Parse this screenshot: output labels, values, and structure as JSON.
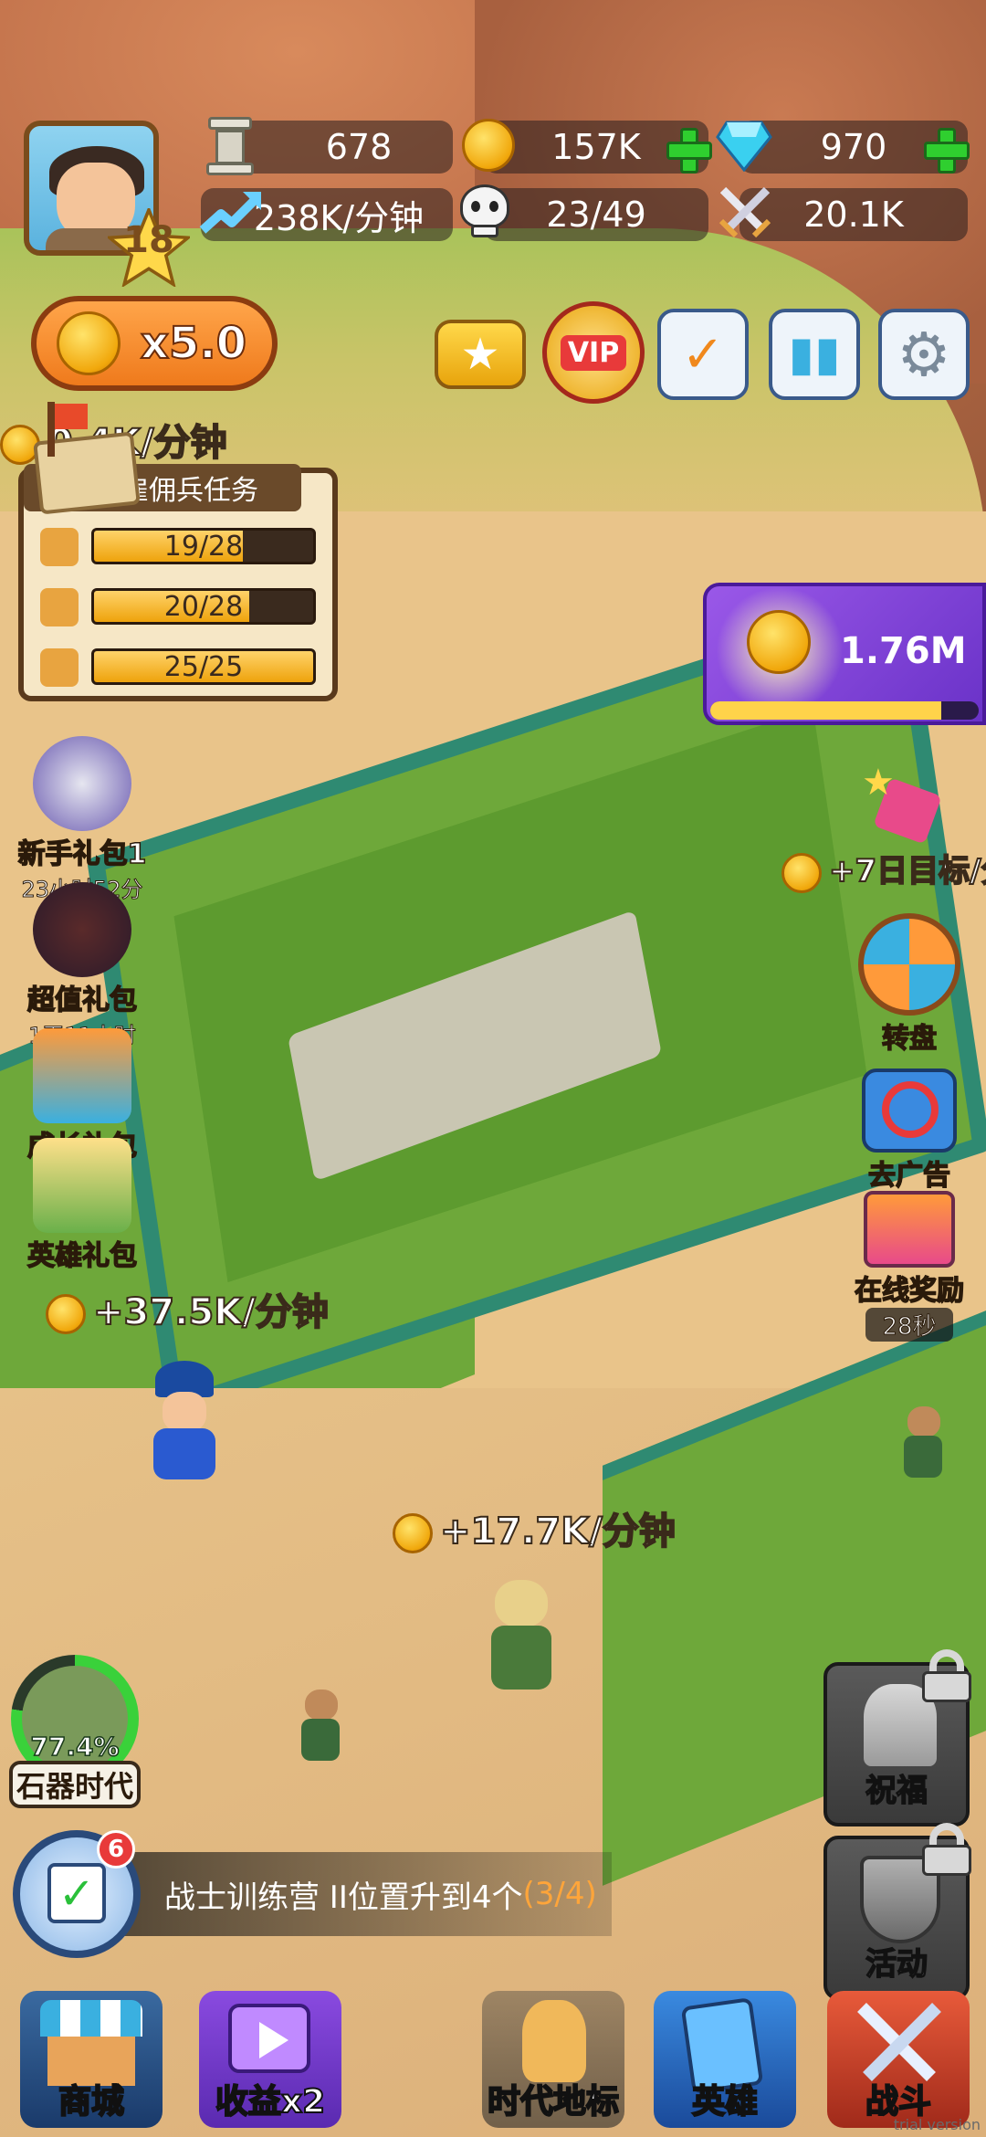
{
  "player": {
    "level": "18"
  },
  "resources": {
    "stone": "678",
    "gold": "157K",
    "gems": "970",
    "income_rate": "238K/分钟",
    "population": "23/49",
    "power": "20.1K"
  },
  "multiplier_button": {
    "label": "x5.0"
  },
  "income_labels": {
    "top": "0.4K/分钟",
    "field": "+37.5K/分钟",
    "camp": "+17.7K/分钟",
    "right": "+7日目标/分"
  },
  "mercenary_task": {
    "title": "雇佣兵任务",
    "rows": [
      {
        "value": "19/28",
        "fill": 0.68
      },
      {
        "value": "20/28",
        "fill": 0.71
      },
      {
        "value": "25/25",
        "fill": 1.0
      }
    ]
  },
  "boost": {
    "value": "1.76M",
    "progress": 0.86
  },
  "left_gifts": [
    {
      "label": "新手礼包1",
      "timer": "23小时52分"
    },
    {
      "label": "超值礼包",
      "timer": "1天11小时"
    },
    {
      "label": "成长礼包",
      "timer": ""
    },
    {
      "label": "英雄礼包",
      "timer": ""
    }
  ],
  "right_items": [
    {
      "label": "转盘"
    },
    {
      "label": "去广告"
    },
    {
      "label": "在线奖励",
      "timer": "28秒"
    }
  ],
  "age": {
    "percent": "77.4%",
    "label": "石器时代",
    "progress": 0.774
  },
  "quest": {
    "badge": "6",
    "text": "战士训练营 II位置升到4个",
    "progress": "(3/4)"
  },
  "locked_buttons": [
    {
      "label": "祝福"
    },
    {
      "label": "活动"
    }
  ],
  "bottom_nav": [
    {
      "label": "商城"
    },
    {
      "label": "收益x2"
    },
    {
      "label": "时代地标"
    },
    {
      "label": "英雄"
    },
    {
      "label": "战斗"
    }
  ],
  "watermark": "trial version",
  "colors": {
    "accent_orange": "#ef7a1c",
    "plus_green": "#2fcf2f",
    "bar_gold": "#eea30c",
    "boost_purple": "#7a3ad8"
  }
}
